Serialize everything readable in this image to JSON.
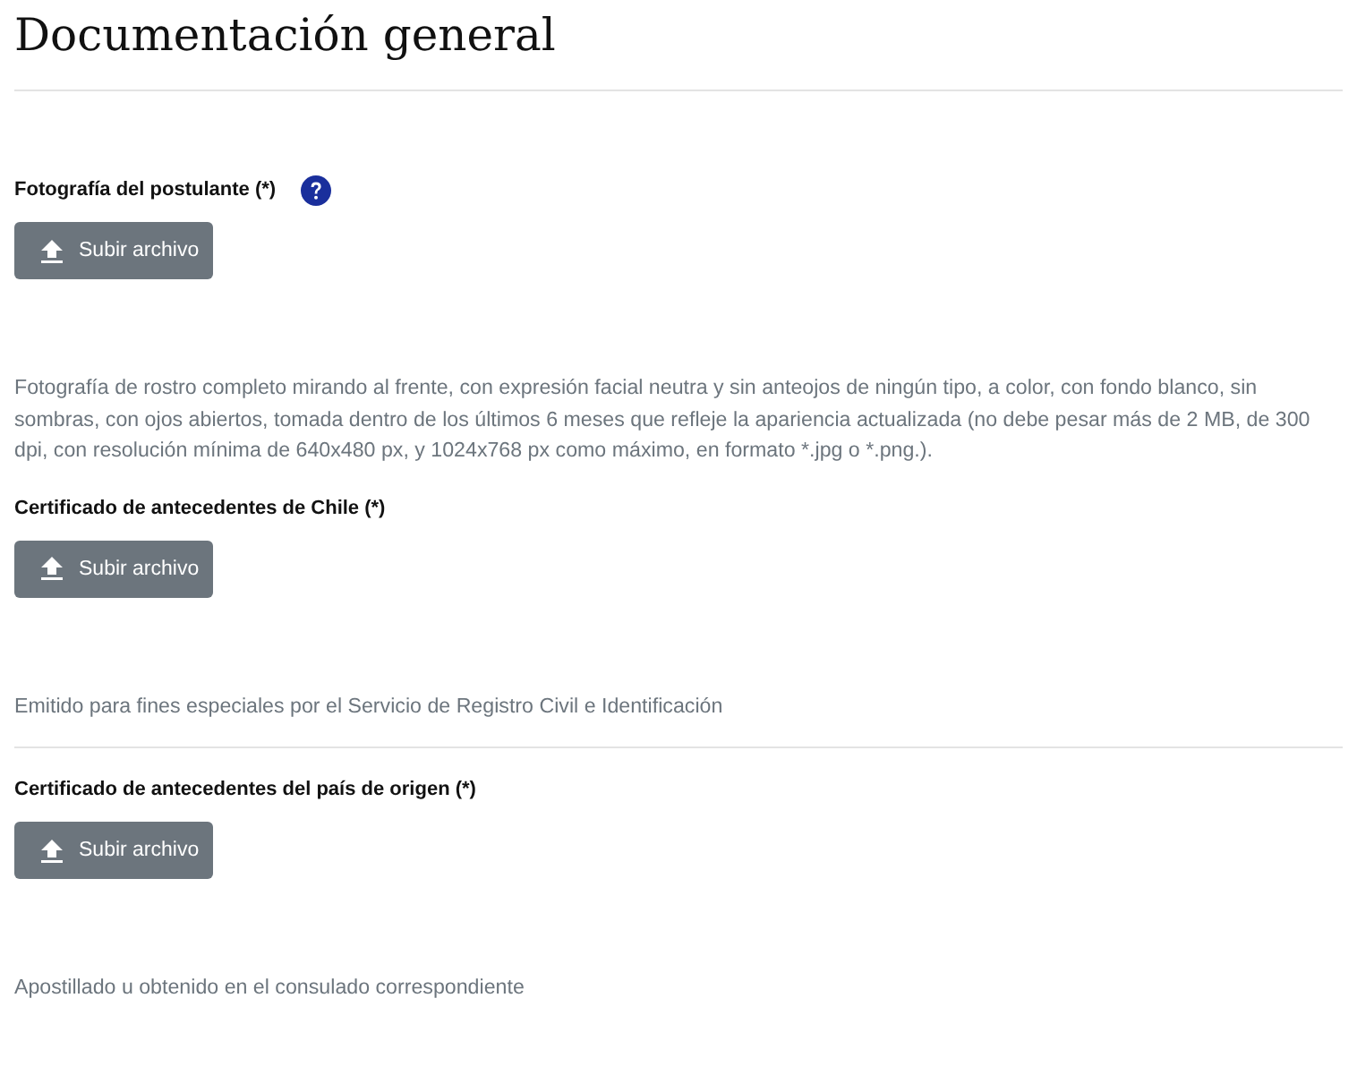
{
  "title": "Documentación general",
  "fields": [
    {
      "label": "Fotografía del postulante (*)",
      "help_icon": true,
      "button": "Subir archivo",
      "hint": "Fotografía de rostro completo mirando al frente, con expresión facial neutra y sin anteojos de ningún tipo, a color, con fondo blanco, sin sombras, con ojos abiertos, tomada dentro de los últimos 6 meses que refleje la apariencia actualizada (no debe pesar más de 2 MB, de 300 dpi, con resolución mínima de 640x480 px, y 1024x768 px como máximo, en formato *.jpg o *.png.).",
      "divider_after": false
    },
    {
      "label": "Certificado de antecedentes de Chile (*)",
      "help_icon": false,
      "button": "Subir archivo",
      "hint": "Emitido para fines especiales por el Servicio de Registro Civil e Identificación",
      "divider_after": true
    },
    {
      "label": "Certificado de antecedentes del país de origen (*)",
      "help_icon": false,
      "button": "Subir archivo",
      "hint": "Apostillado u obtenido en el consulado correspondiente",
      "divider_after": false
    }
  ]
}
